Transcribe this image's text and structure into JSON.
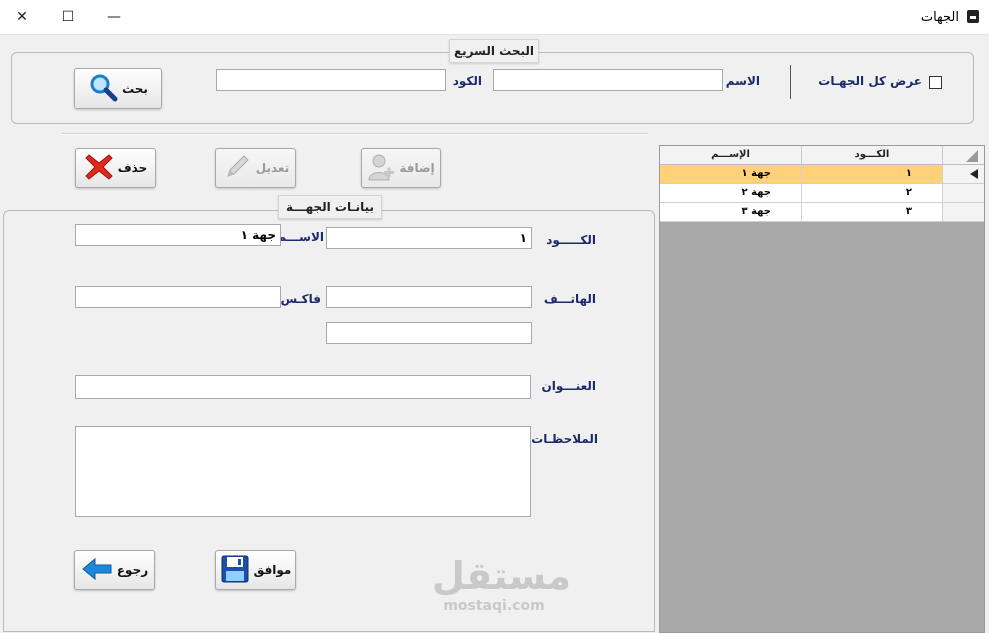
{
  "window": {
    "title": "الجهات",
    "controls": {
      "close": "✕",
      "maximize": "☐",
      "minimize": "—"
    }
  },
  "quick_search": {
    "title": "البحث السريع",
    "show_all_label": "عرض كل الجهـات",
    "name_label": "الاسم",
    "name_value": "",
    "code_label": "الكود",
    "code_value": "",
    "search_button": "بحث"
  },
  "toolbar": {
    "add_button": "إضافة",
    "edit_button": "تعديل",
    "delete_button": "حذف"
  },
  "form": {
    "title": "بيانـات الجهـــة",
    "code_label": "الكـــــود",
    "code_value": "١",
    "name_label": "الاســـم",
    "name_value": "جهة ١",
    "phone_label": "الهاتـــف",
    "phone_value": "",
    "phone2_value": "",
    "fax_label": "فاكـس",
    "fax_value": "",
    "address_label": "العنـــوان",
    "address_value": "",
    "notes_label": "الملاحظـات",
    "notes_value": "",
    "ok_button": "موافق",
    "back_button": "رجوع"
  },
  "grid": {
    "columns": [
      "الإســـم",
      "الكـــود"
    ],
    "rows": [
      {
        "name": "جهة ١",
        "code": "١",
        "selected": true
      },
      {
        "name": "جهة ٢",
        "code": "٢",
        "selected": false
      },
      {
        "name": "جهة ٣",
        "code": "٣",
        "selected": false
      }
    ]
  },
  "watermark": {
    "arabic": "مستقل",
    "latin": "mostaqi.com"
  },
  "colors": {
    "label_blue": "#1b2a6b",
    "selected_row": "#ffd27a",
    "delete_red": "#e0281c",
    "arrow_blue": "#1e88d8"
  }
}
